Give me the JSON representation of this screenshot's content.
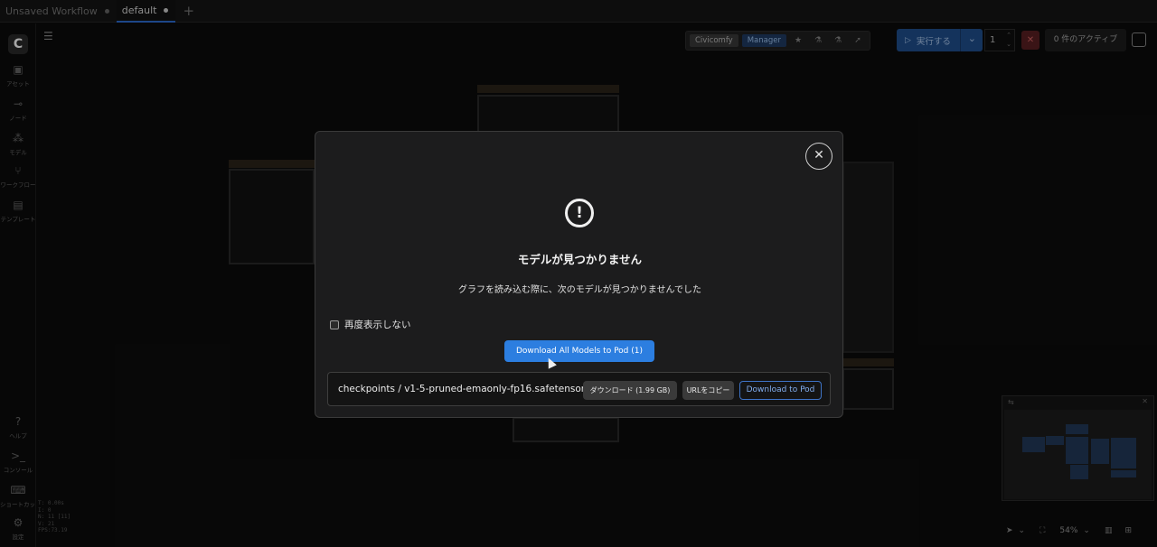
{
  "tabs": [
    {
      "label": "Unsaved Workflow",
      "active": false
    },
    {
      "label": "default",
      "active": true
    }
  ],
  "tab_add_icon": "plus-icon",
  "sidebar": {
    "logo": "C",
    "items": [
      {
        "icon": "image-icon",
        "label": "アセット"
      },
      {
        "icon": "node-icon",
        "label": "ノード"
      },
      {
        "icon": "model-icon",
        "label": "モデル"
      },
      {
        "icon": "workflow-icon",
        "label": "ワークフロー"
      },
      {
        "icon": "template-icon",
        "label": "テンプレート"
      }
    ],
    "bottom_items": [
      {
        "icon": "help-icon",
        "label": "ヘルプ"
      },
      {
        "icon": "terminal-icon",
        "label": "コンソール"
      },
      {
        "icon": "keyboard-icon",
        "label": "ショートカット"
      },
      {
        "icon": "gear-icon",
        "label": "設定"
      }
    ],
    "stats": [
      "T: 0.00s",
      "I: 0",
      "N: 11 [11]",
      "V: 21",
      "FPS:73.19"
    ]
  },
  "toolbar": {
    "civicomfy": "Civicomfy",
    "manager": "Manager",
    "run_label": "実行する",
    "queue_count": "1",
    "active_label": "0 件のアクティブ"
  },
  "modal": {
    "title": "モデルが見つかりません",
    "description": "グラフを読み込む際に、次のモデルが見つかりませんでした",
    "checkbox_label": "再度表示しない",
    "download_all_label": "Download All Models to Pod (1)",
    "model": {
      "name": "checkpoints / v1-5-pruned-emaonly-fp16.safetensors",
      "download_label": "ダウンロード (1.99 GB)",
      "copy_url_label": "URLをコピー",
      "download_to_pod_label": "Download to Pod"
    }
  },
  "minimap": {
    "zoom": "54%"
  },
  "colors": {
    "accent": "#2c7ee0",
    "run_button": "#1f4f8e",
    "stop_button": "#5a2022",
    "background": "#0c0c0c",
    "modal": "#1c1c1d"
  }
}
